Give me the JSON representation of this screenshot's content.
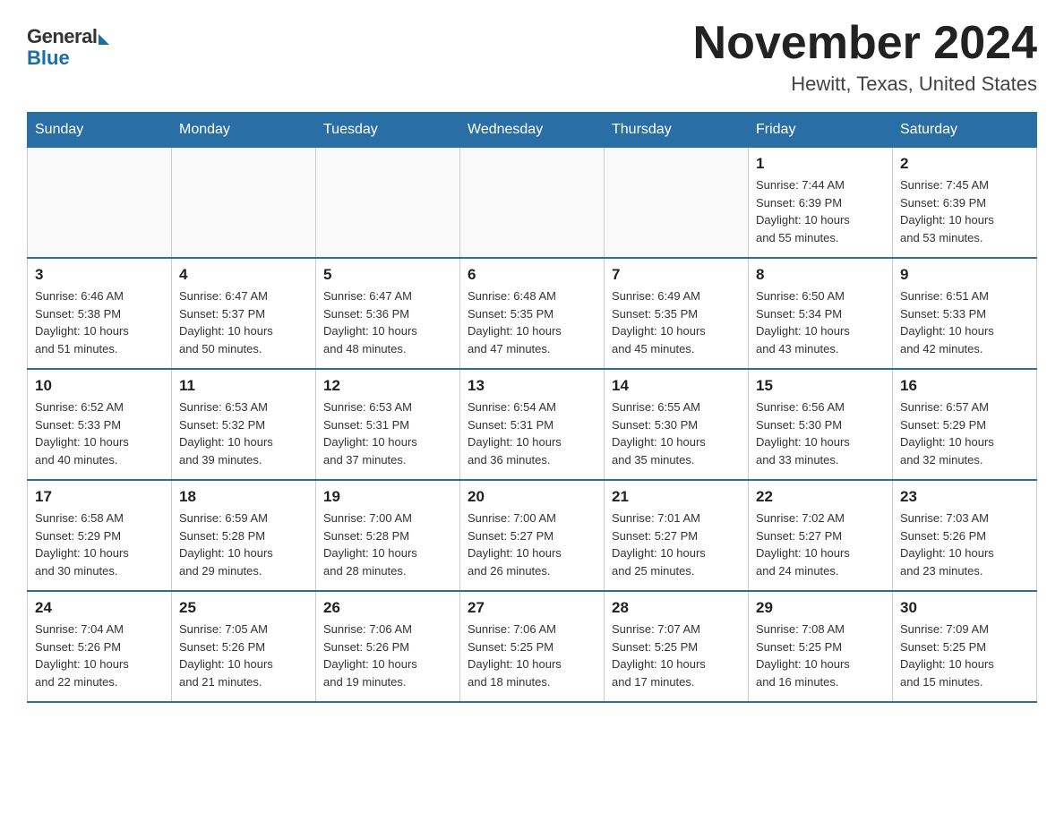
{
  "header": {
    "logo_general": "General",
    "logo_blue": "Blue",
    "title": "November 2024",
    "subtitle": "Hewitt, Texas, United States"
  },
  "days_of_week": [
    "Sunday",
    "Monday",
    "Tuesday",
    "Wednesday",
    "Thursday",
    "Friday",
    "Saturday"
  ],
  "weeks": [
    {
      "days": [
        {
          "number": "",
          "info": "",
          "empty": true
        },
        {
          "number": "",
          "info": "",
          "empty": true
        },
        {
          "number": "",
          "info": "",
          "empty": true
        },
        {
          "number": "",
          "info": "",
          "empty": true
        },
        {
          "number": "",
          "info": "",
          "empty": true
        },
        {
          "number": "1",
          "info": "Sunrise: 7:44 AM\nSunset: 6:39 PM\nDaylight: 10 hours\nand 55 minutes.",
          "empty": false
        },
        {
          "number": "2",
          "info": "Sunrise: 7:45 AM\nSunset: 6:39 PM\nDaylight: 10 hours\nand 53 minutes.",
          "empty": false
        }
      ]
    },
    {
      "days": [
        {
          "number": "3",
          "info": "Sunrise: 6:46 AM\nSunset: 5:38 PM\nDaylight: 10 hours\nand 51 minutes.",
          "empty": false
        },
        {
          "number": "4",
          "info": "Sunrise: 6:47 AM\nSunset: 5:37 PM\nDaylight: 10 hours\nand 50 minutes.",
          "empty": false
        },
        {
          "number": "5",
          "info": "Sunrise: 6:47 AM\nSunset: 5:36 PM\nDaylight: 10 hours\nand 48 minutes.",
          "empty": false
        },
        {
          "number": "6",
          "info": "Sunrise: 6:48 AM\nSunset: 5:35 PM\nDaylight: 10 hours\nand 47 minutes.",
          "empty": false
        },
        {
          "number": "7",
          "info": "Sunrise: 6:49 AM\nSunset: 5:35 PM\nDaylight: 10 hours\nand 45 minutes.",
          "empty": false
        },
        {
          "number": "8",
          "info": "Sunrise: 6:50 AM\nSunset: 5:34 PM\nDaylight: 10 hours\nand 43 minutes.",
          "empty": false
        },
        {
          "number": "9",
          "info": "Sunrise: 6:51 AM\nSunset: 5:33 PM\nDaylight: 10 hours\nand 42 minutes.",
          "empty": false
        }
      ]
    },
    {
      "days": [
        {
          "number": "10",
          "info": "Sunrise: 6:52 AM\nSunset: 5:33 PM\nDaylight: 10 hours\nand 40 minutes.",
          "empty": false
        },
        {
          "number": "11",
          "info": "Sunrise: 6:53 AM\nSunset: 5:32 PM\nDaylight: 10 hours\nand 39 minutes.",
          "empty": false
        },
        {
          "number": "12",
          "info": "Sunrise: 6:53 AM\nSunset: 5:31 PM\nDaylight: 10 hours\nand 37 minutes.",
          "empty": false
        },
        {
          "number": "13",
          "info": "Sunrise: 6:54 AM\nSunset: 5:31 PM\nDaylight: 10 hours\nand 36 minutes.",
          "empty": false
        },
        {
          "number": "14",
          "info": "Sunrise: 6:55 AM\nSunset: 5:30 PM\nDaylight: 10 hours\nand 35 minutes.",
          "empty": false
        },
        {
          "number": "15",
          "info": "Sunrise: 6:56 AM\nSunset: 5:30 PM\nDaylight: 10 hours\nand 33 minutes.",
          "empty": false
        },
        {
          "number": "16",
          "info": "Sunrise: 6:57 AM\nSunset: 5:29 PM\nDaylight: 10 hours\nand 32 minutes.",
          "empty": false
        }
      ]
    },
    {
      "days": [
        {
          "number": "17",
          "info": "Sunrise: 6:58 AM\nSunset: 5:29 PM\nDaylight: 10 hours\nand 30 minutes.",
          "empty": false
        },
        {
          "number": "18",
          "info": "Sunrise: 6:59 AM\nSunset: 5:28 PM\nDaylight: 10 hours\nand 29 minutes.",
          "empty": false
        },
        {
          "number": "19",
          "info": "Sunrise: 7:00 AM\nSunset: 5:28 PM\nDaylight: 10 hours\nand 28 minutes.",
          "empty": false
        },
        {
          "number": "20",
          "info": "Sunrise: 7:00 AM\nSunset: 5:27 PM\nDaylight: 10 hours\nand 26 minutes.",
          "empty": false
        },
        {
          "number": "21",
          "info": "Sunrise: 7:01 AM\nSunset: 5:27 PM\nDaylight: 10 hours\nand 25 minutes.",
          "empty": false
        },
        {
          "number": "22",
          "info": "Sunrise: 7:02 AM\nSunset: 5:27 PM\nDaylight: 10 hours\nand 24 minutes.",
          "empty": false
        },
        {
          "number": "23",
          "info": "Sunrise: 7:03 AM\nSunset: 5:26 PM\nDaylight: 10 hours\nand 23 minutes.",
          "empty": false
        }
      ]
    },
    {
      "days": [
        {
          "number": "24",
          "info": "Sunrise: 7:04 AM\nSunset: 5:26 PM\nDaylight: 10 hours\nand 22 minutes.",
          "empty": false
        },
        {
          "number": "25",
          "info": "Sunrise: 7:05 AM\nSunset: 5:26 PM\nDaylight: 10 hours\nand 21 minutes.",
          "empty": false
        },
        {
          "number": "26",
          "info": "Sunrise: 7:06 AM\nSunset: 5:26 PM\nDaylight: 10 hours\nand 19 minutes.",
          "empty": false
        },
        {
          "number": "27",
          "info": "Sunrise: 7:06 AM\nSunset: 5:25 PM\nDaylight: 10 hours\nand 18 minutes.",
          "empty": false
        },
        {
          "number": "28",
          "info": "Sunrise: 7:07 AM\nSunset: 5:25 PM\nDaylight: 10 hours\nand 17 minutes.",
          "empty": false
        },
        {
          "number": "29",
          "info": "Sunrise: 7:08 AM\nSunset: 5:25 PM\nDaylight: 10 hours\nand 16 minutes.",
          "empty": false
        },
        {
          "number": "30",
          "info": "Sunrise: 7:09 AM\nSunset: 5:25 PM\nDaylight: 10 hours\nand 15 minutes.",
          "empty": false
        }
      ]
    }
  ]
}
